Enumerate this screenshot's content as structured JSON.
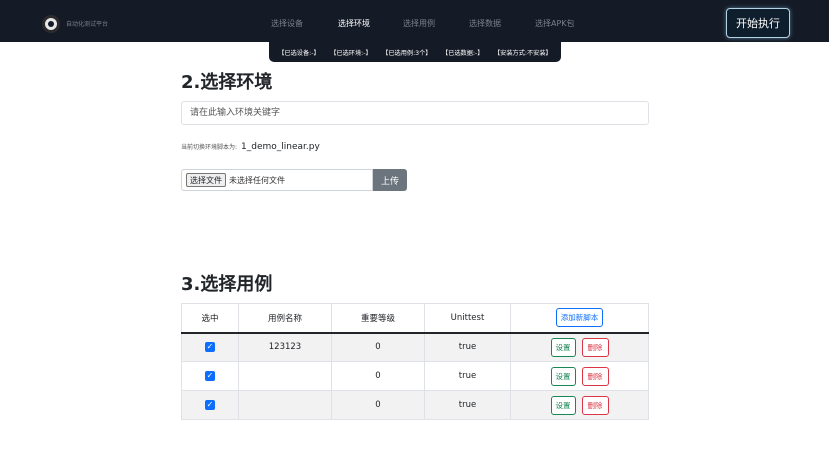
{
  "brand": {
    "name": "自动化测试平台"
  },
  "nav": [
    "选择设备",
    "选择环境",
    "选择用例",
    "选择数据",
    "选择APK包"
  ],
  "start_button": "开始执行",
  "summary": [
    "【已选设备:-】",
    "【已选环境:-】",
    "【已选用例:3个】",
    "【已选数据:-】",
    "【安装方式:不安装】"
  ],
  "env_section": {
    "title": "2.选择环境",
    "search_placeholder": "请在此输入环境关键字",
    "current_label": "当前切换环境脚本为:",
    "current_value": "1_demo_linear.py",
    "file_button": "选择文件",
    "file_status": "未选择任何文件",
    "upload_button": "上传"
  },
  "case_section": {
    "title": "3.选择用例",
    "headers": [
      "选中",
      "用例名称",
      "重要等级",
      "Unittest"
    ],
    "add_button": "添加新脚本",
    "rows": [
      {
        "name": "123123",
        "level": "0",
        "unittest": "true"
      },
      {
        "name": "",
        "level": "0",
        "unittest": "true"
      },
      {
        "name": "",
        "level": "0",
        "unittest": "true"
      }
    ],
    "set_label": "设置",
    "delete_label": "删除"
  }
}
